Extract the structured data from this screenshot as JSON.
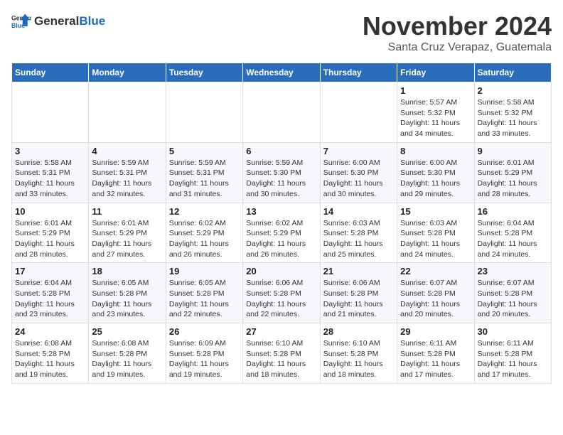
{
  "logo": {
    "general": "General",
    "blue": "Blue"
  },
  "title": {
    "month": "November 2024",
    "location": "Santa Cruz Verapaz, Guatemala"
  },
  "calendar": {
    "headers": [
      "Sunday",
      "Monday",
      "Tuesday",
      "Wednesday",
      "Thursday",
      "Friday",
      "Saturday"
    ],
    "weeks": [
      [
        {
          "day": "",
          "info": ""
        },
        {
          "day": "",
          "info": ""
        },
        {
          "day": "",
          "info": ""
        },
        {
          "day": "",
          "info": ""
        },
        {
          "day": "",
          "info": ""
        },
        {
          "day": "1",
          "info": "Sunrise: 5:57 AM\nSunset: 5:32 PM\nDaylight: 11 hours and 34 minutes."
        },
        {
          "day": "2",
          "info": "Sunrise: 5:58 AM\nSunset: 5:32 PM\nDaylight: 11 hours and 33 minutes."
        }
      ],
      [
        {
          "day": "3",
          "info": "Sunrise: 5:58 AM\nSunset: 5:31 PM\nDaylight: 11 hours and 33 minutes."
        },
        {
          "day": "4",
          "info": "Sunrise: 5:59 AM\nSunset: 5:31 PM\nDaylight: 11 hours and 32 minutes."
        },
        {
          "day": "5",
          "info": "Sunrise: 5:59 AM\nSunset: 5:31 PM\nDaylight: 11 hours and 31 minutes."
        },
        {
          "day": "6",
          "info": "Sunrise: 5:59 AM\nSunset: 5:30 PM\nDaylight: 11 hours and 30 minutes."
        },
        {
          "day": "7",
          "info": "Sunrise: 6:00 AM\nSunset: 5:30 PM\nDaylight: 11 hours and 30 minutes."
        },
        {
          "day": "8",
          "info": "Sunrise: 6:00 AM\nSunset: 5:30 PM\nDaylight: 11 hours and 29 minutes."
        },
        {
          "day": "9",
          "info": "Sunrise: 6:01 AM\nSunset: 5:29 PM\nDaylight: 11 hours and 28 minutes."
        }
      ],
      [
        {
          "day": "10",
          "info": "Sunrise: 6:01 AM\nSunset: 5:29 PM\nDaylight: 11 hours and 28 minutes."
        },
        {
          "day": "11",
          "info": "Sunrise: 6:01 AM\nSunset: 5:29 PM\nDaylight: 11 hours and 27 minutes."
        },
        {
          "day": "12",
          "info": "Sunrise: 6:02 AM\nSunset: 5:29 PM\nDaylight: 11 hours and 26 minutes."
        },
        {
          "day": "13",
          "info": "Sunrise: 6:02 AM\nSunset: 5:29 PM\nDaylight: 11 hours and 26 minutes."
        },
        {
          "day": "14",
          "info": "Sunrise: 6:03 AM\nSunset: 5:28 PM\nDaylight: 11 hours and 25 minutes."
        },
        {
          "day": "15",
          "info": "Sunrise: 6:03 AM\nSunset: 5:28 PM\nDaylight: 11 hours and 24 minutes."
        },
        {
          "day": "16",
          "info": "Sunrise: 6:04 AM\nSunset: 5:28 PM\nDaylight: 11 hours and 24 minutes."
        }
      ],
      [
        {
          "day": "17",
          "info": "Sunrise: 6:04 AM\nSunset: 5:28 PM\nDaylight: 11 hours and 23 minutes."
        },
        {
          "day": "18",
          "info": "Sunrise: 6:05 AM\nSunset: 5:28 PM\nDaylight: 11 hours and 23 minutes."
        },
        {
          "day": "19",
          "info": "Sunrise: 6:05 AM\nSunset: 5:28 PM\nDaylight: 11 hours and 22 minutes."
        },
        {
          "day": "20",
          "info": "Sunrise: 6:06 AM\nSunset: 5:28 PM\nDaylight: 11 hours and 22 minutes."
        },
        {
          "day": "21",
          "info": "Sunrise: 6:06 AM\nSunset: 5:28 PM\nDaylight: 11 hours and 21 minutes."
        },
        {
          "day": "22",
          "info": "Sunrise: 6:07 AM\nSunset: 5:28 PM\nDaylight: 11 hours and 20 minutes."
        },
        {
          "day": "23",
          "info": "Sunrise: 6:07 AM\nSunset: 5:28 PM\nDaylight: 11 hours and 20 minutes."
        }
      ],
      [
        {
          "day": "24",
          "info": "Sunrise: 6:08 AM\nSunset: 5:28 PM\nDaylight: 11 hours and 19 minutes."
        },
        {
          "day": "25",
          "info": "Sunrise: 6:08 AM\nSunset: 5:28 PM\nDaylight: 11 hours and 19 minutes."
        },
        {
          "day": "26",
          "info": "Sunrise: 6:09 AM\nSunset: 5:28 PM\nDaylight: 11 hours and 19 minutes."
        },
        {
          "day": "27",
          "info": "Sunrise: 6:10 AM\nSunset: 5:28 PM\nDaylight: 11 hours and 18 minutes."
        },
        {
          "day": "28",
          "info": "Sunrise: 6:10 AM\nSunset: 5:28 PM\nDaylight: 11 hours and 18 minutes."
        },
        {
          "day": "29",
          "info": "Sunrise: 6:11 AM\nSunset: 5:28 PM\nDaylight: 11 hours and 17 minutes."
        },
        {
          "day": "30",
          "info": "Sunrise: 6:11 AM\nSunset: 5:28 PM\nDaylight: 11 hours and 17 minutes."
        }
      ]
    ]
  }
}
